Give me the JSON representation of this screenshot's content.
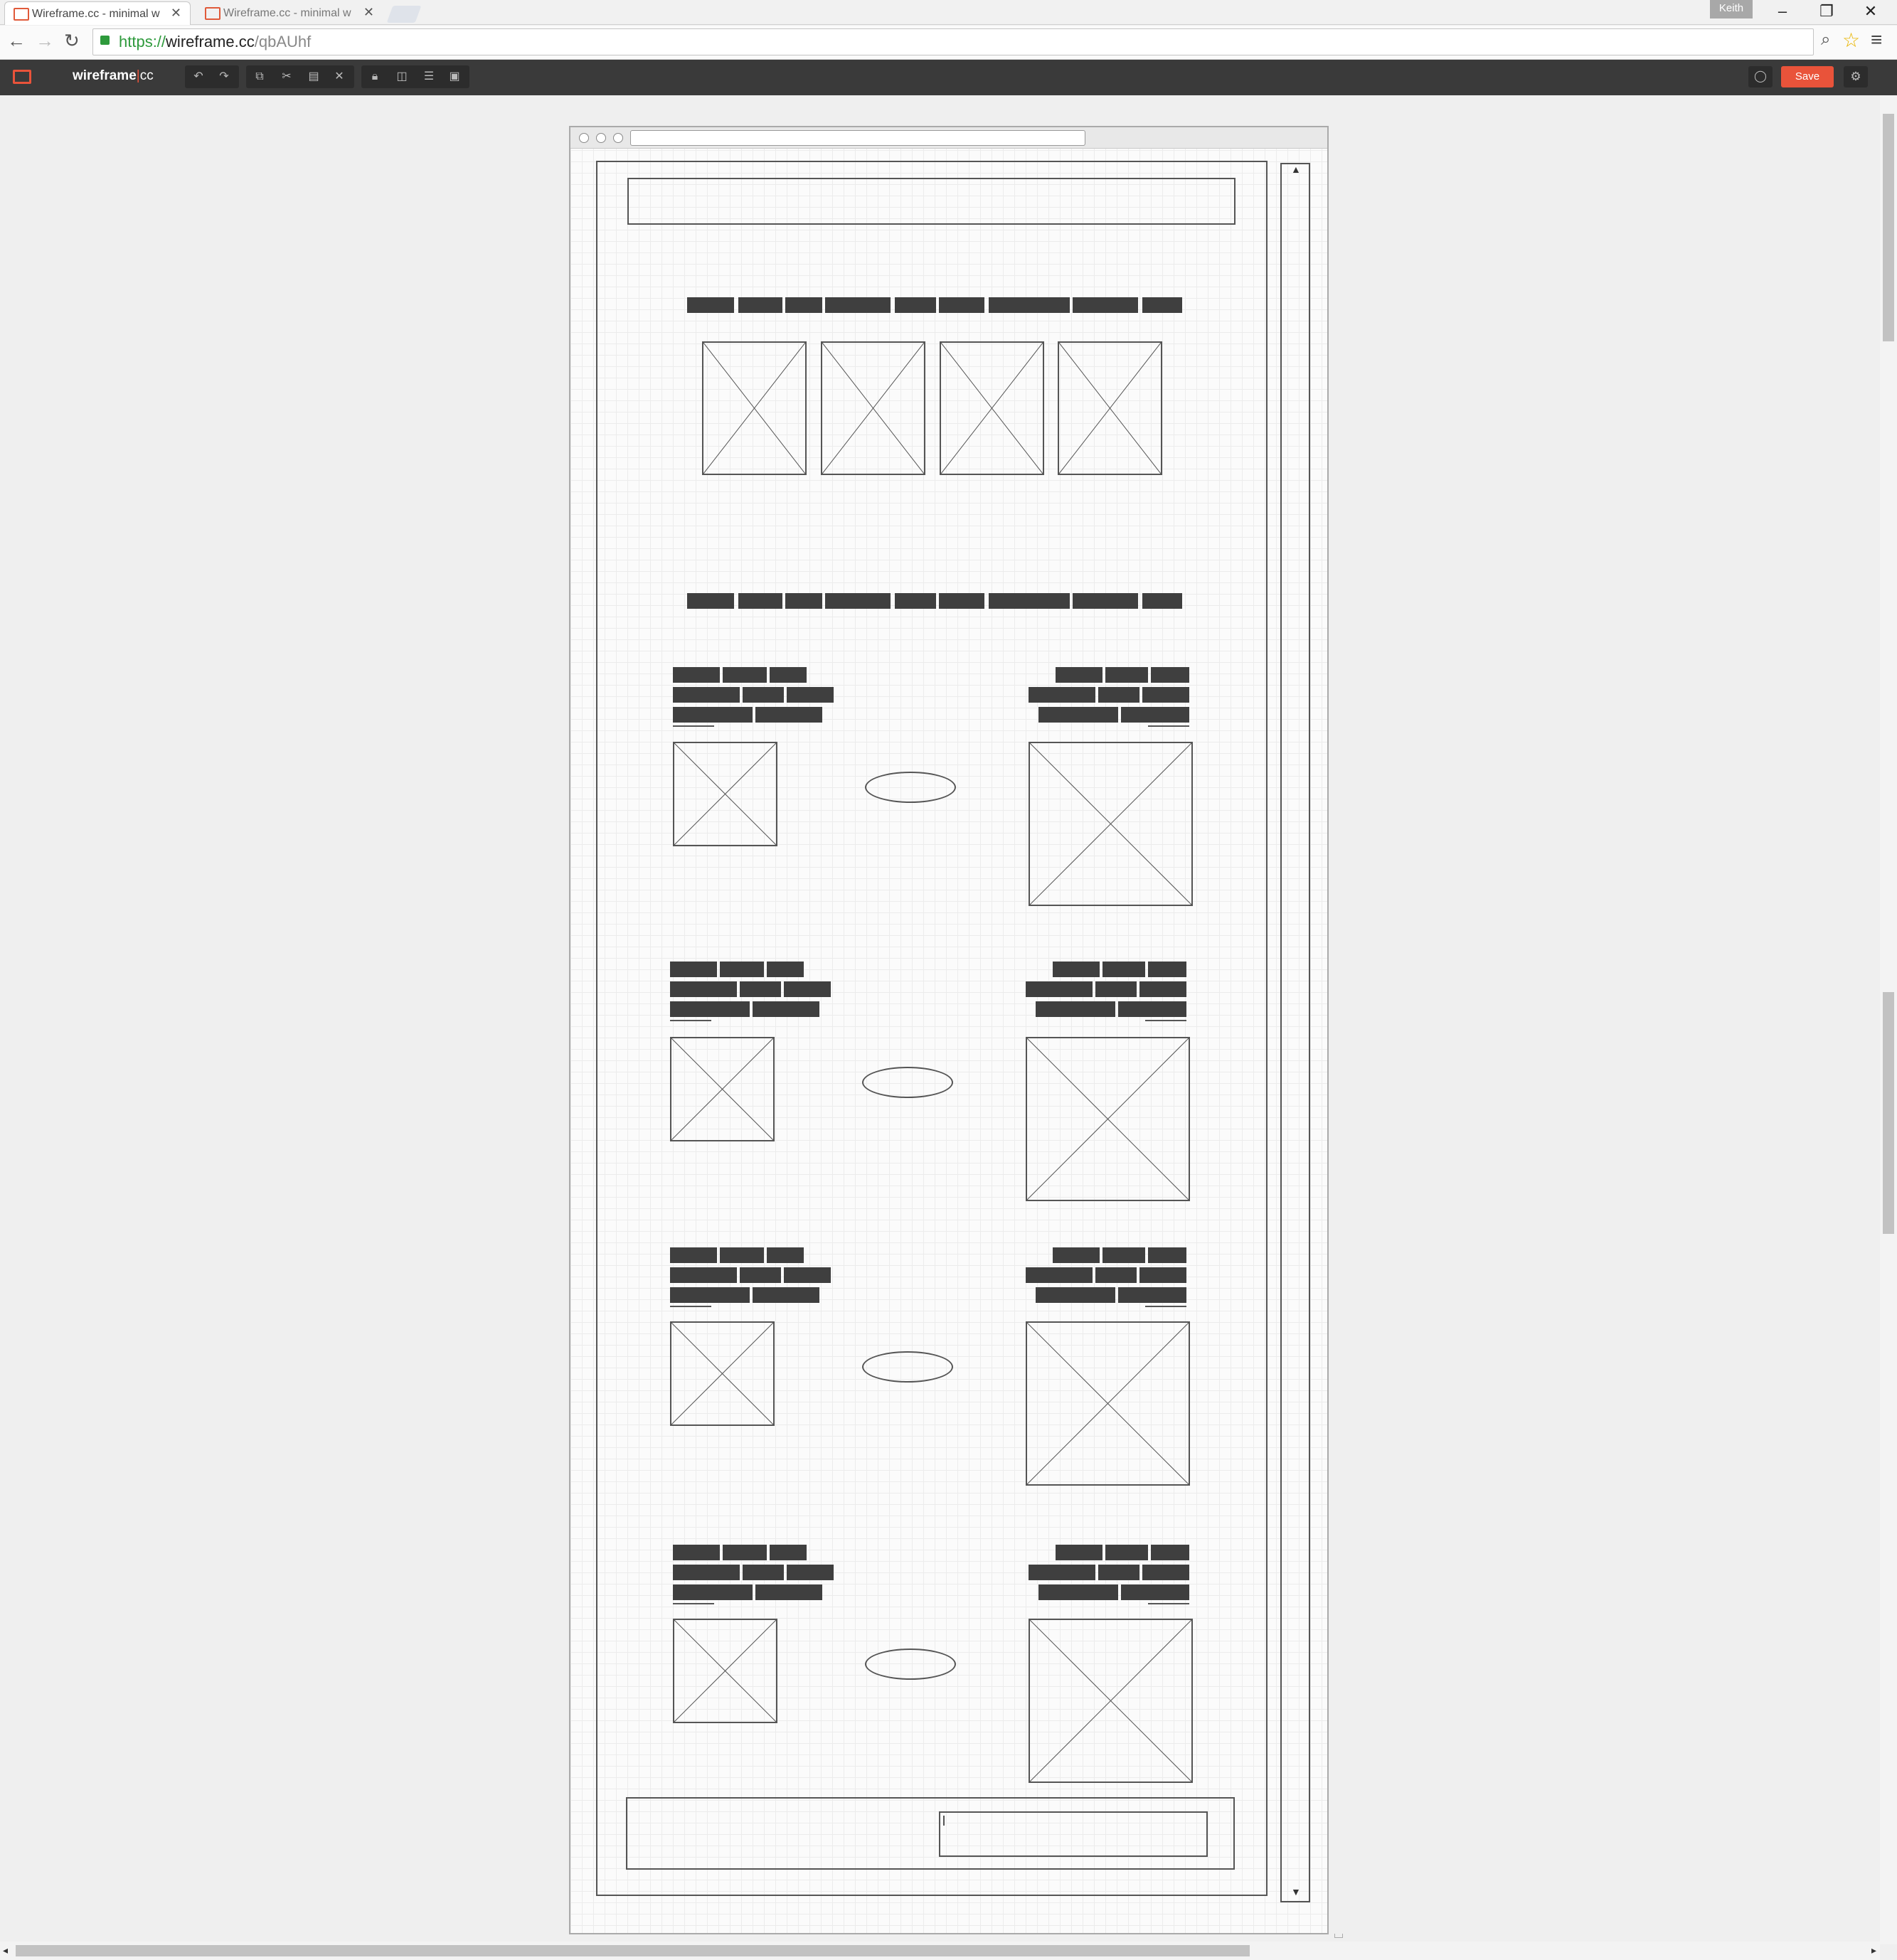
{
  "browser": {
    "tabs": [
      {
        "title": "Wireframe.cc - minimal w",
        "active": true
      },
      {
        "title": "Wireframe.cc - minimal w",
        "active": false
      }
    ],
    "user": "Keith",
    "url": {
      "scheme": "https://",
      "host": "wireframe.cc",
      "path": "/qbAUhf"
    }
  },
  "app": {
    "name": "wireframe",
    "name_suffix": "cc",
    "save_label": "Save",
    "accent_color": "#e9533a",
    "toolbar_icons": [
      "undo-icon",
      "redo-icon",
      "copy-icon",
      "cut-icon",
      "paste-icon",
      "delete-icon",
      "lock-icon",
      "bring-front-icon",
      "align-icon",
      "group-icon"
    ]
  },
  "wireframe": {
    "nav_rows": 2,
    "sections": 4,
    "placeholder_image_count": 12
  }
}
